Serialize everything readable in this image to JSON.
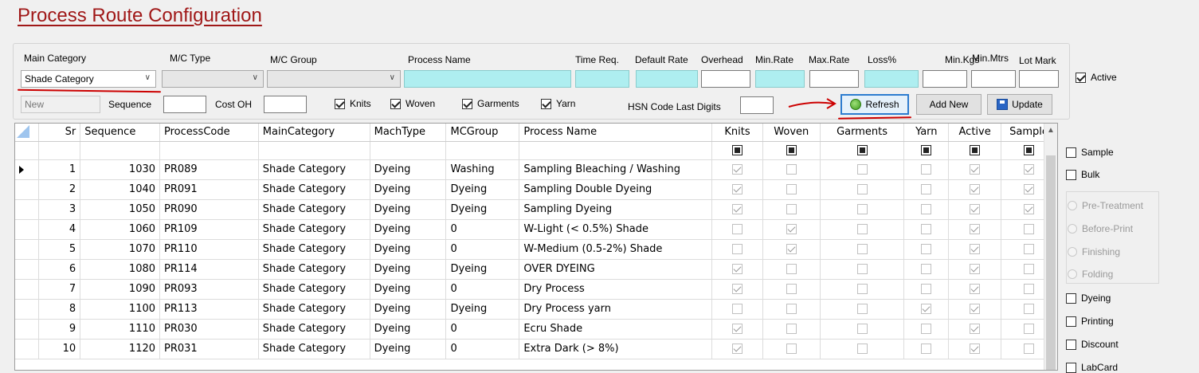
{
  "title": "Process Route Configuration",
  "filters": {
    "main_category_label": "Main Category",
    "main_category_value": "Shade Category",
    "mc_type_label": "M/C Type",
    "mc_group_label": "M/C Group",
    "process_name_label": "Process Name",
    "time_req_label": "Time Req.",
    "default_rate_label": "Default Rate",
    "overhead_label": "Overhead",
    "min_rate_label": "Min.Rate",
    "max_rate_label": "Max.Rate",
    "loss_label": "Loss%",
    "min_kgs_label": "Min.Kgs",
    "min_mtrs_label": "Min.Mtrs",
    "lot_mark_label": "Lot Mark",
    "active_label": "Active",
    "new_placeholder": "New",
    "sequence_label": "Sequence",
    "cost_oh_label": "Cost OH",
    "knits_label": "Knits",
    "woven_label": "Woven",
    "garments_label": "Garments",
    "yarn_label": "Yarn",
    "hsn_label": "HSN Code Last Digits"
  },
  "buttons": {
    "refresh": "Refresh",
    "add_new": "Add New",
    "update": "Update"
  },
  "grid": {
    "columns": [
      "Sr",
      "Sequence",
      "ProcessCode",
      "MainCategory",
      "MachType",
      "MCGroup",
      "Process Name",
      "Knits",
      "Woven",
      "Garments",
      "Yarn",
      "Active",
      "Sample"
    ],
    "rows": [
      {
        "sr": "1",
        "seq": "1030",
        "code": "PR089",
        "cat": "Shade Category",
        "mach": "Dyeing",
        "grp": "Washing",
        "name": "Sampling Bleaching / Washing",
        "k": true,
        "w": false,
        "g": false,
        "y": false,
        "a": true,
        "s": true
      },
      {
        "sr": "2",
        "seq": "1040",
        "code": "PR091",
        "cat": "Shade Category",
        "mach": "Dyeing",
        "grp": "Dyeing",
        "name": "Sampling Double Dyeing",
        "k": true,
        "w": false,
        "g": false,
        "y": false,
        "a": true,
        "s": true
      },
      {
        "sr": "3",
        "seq": "1050",
        "code": "PR090",
        "cat": "Shade Category",
        "mach": "Dyeing",
        "grp": "Dyeing",
        "name": "Sampling Dyeing",
        "k": true,
        "w": false,
        "g": false,
        "y": false,
        "a": true,
        "s": true
      },
      {
        "sr": "4",
        "seq": "1060",
        "code": "PR109",
        "cat": "Shade Category",
        "mach": "Dyeing",
        "grp": "0",
        "name": "W-Light (< 0.5%) Shade",
        "k": false,
        "w": true,
        "g": false,
        "y": false,
        "a": true,
        "s": false
      },
      {
        "sr": "5",
        "seq": "1070",
        "code": "PR110",
        "cat": "Shade Category",
        "mach": "Dyeing",
        "grp": "0",
        "name": "W-Medium (0.5-2%) Shade",
        "k": false,
        "w": true,
        "g": false,
        "y": false,
        "a": true,
        "s": false
      },
      {
        "sr": "6",
        "seq": "1080",
        "code": "PR114",
        "cat": "Shade Category",
        "mach": "Dyeing",
        "grp": "Dyeing",
        "name": "OVER DYEING",
        "k": true,
        "w": false,
        "g": false,
        "y": false,
        "a": true,
        "s": false
      },
      {
        "sr": "7",
        "seq": "1090",
        "code": "PR093",
        "cat": "Shade Category",
        "mach": "Dyeing",
        "grp": "0",
        "name": "Dry Process",
        "k": true,
        "w": false,
        "g": false,
        "y": false,
        "a": true,
        "s": false
      },
      {
        "sr": "8",
        "seq": "1100",
        "code": "PR113",
        "cat": "Shade Category",
        "mach": "Dyeing",
        "grp": "Dyeing",
        "name": "Dry Process yarn",
        "k": false,
        "w": false,
        "g": false,
        "y": true,
        "a": true,
        "s": false
      },
      {
        "sr": "9",
        "seq": "1110",
        "code": "PR030",
        "cat": "Shade Category",
        "mach": "Dyeing",
        "grp": "0",
        "name": "Ecru Shade",
        "k": true,
        "w": false,
        "g": false,
        "y": false,
        "a": true,
        "s": false
      },
      {
        "sr": "10",
        "seq": "1120",
        "code": "PR031",
        "cat": "Shade Category",
        "mach": "Dyeing",
        "grp": "0",
        "name": "Extra Dark (> 8%)",
        "k": true,
        "w": false,
        "g": false,
        "y": false,
        "a": true,
        "s": false
      }
    ]
  },
  "side": {
    "sample": "Sample",
    "bulk": "Bulk",
    "radios": [
      "Pre-Treatment",
      "Before-Print",
      "Finishing",
      "Folding"
    ],
    "dyeing": "Dyeing",
    "printing": "Printing",
    "discount": "Discount",
    "labcard": "LabCard"
  }
}
